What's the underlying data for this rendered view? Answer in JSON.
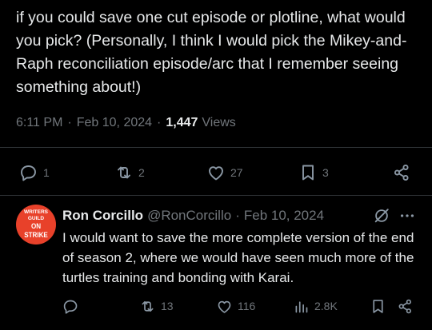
{
  "post": {
    "text": "if you could save one cut episode or plotline, what would you pick? (Personally, I think I would pick the Mikey-and-Raph reconciliation episode/arc that I remember seeing something about!)",
    "time": "6:11 PM",
    "separator": "·",
    "date": "Feb 10, 2024",
    "views_count": "1,447",
    "views_label": "Views",
    "actions": {
      "reply_count": "1",
      "repost_count": "2",
      "like_count": "27",
      "bookmark_count": "3"
    }
  },
  "reply": {
    "avatar_line1": "WRITERS GUILD",
    "avatar_line2": "ON STRIKE",
    "display_name": "Ron Corcillo",
    "handle": "@RonCorcillo",
    "separator": "·",
    "date": "Feb 10, 2024",
    "text": "I would want to save the more complete version of the end of season 2, where we would have seen much more of the turtles training and bonding with Karai.",
    "actions": {
      "repost_count": "13",
      "like_count": "116",
      "views_count": "2.8K"
    }
  },
  "colors": {
    "background": "#000000",
    "text_primary": "#e7e9ea",
    "text_secondary": "#71767b",
    "icon": "#8b98a5",
    "divider": "#2f3336",
    "avatar_bg": "#e8412a"
  },
  "icons": [
    "reply-icon",
    "repost-icon",
    "like-icon",
    "bookmark-icon",
    "share-icon",
    "grok-icon",
    "more-icon",
    "views-icon"
  ]
}
